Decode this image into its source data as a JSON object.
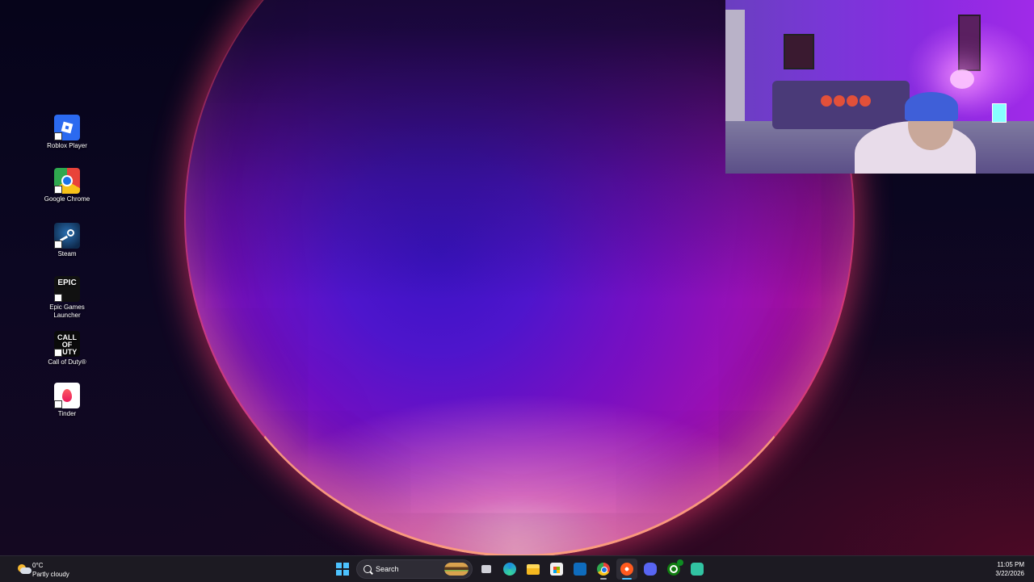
{
  "desktop": {
    "icons": [
      {
        "label": "Roblox Player",
        "icon": "roblox-icon"
      },
      {
        "label": "Google Chrome",
        "icon": "chrome-icon"
      },
      {
        "label": "Steam",
        "icon": "steam-icon"
      },
      {
        "label": "Epic Games Launcher",
        "icon": "epic-games-icon",
        "glyph": "EPIC"
      },
      {
        "label": "Call of Duty®",
        "icon": "call-of-duty-icon",
        "glyph": "CALL OF DUTY"
      },
      {
        "label": "Tinder",
        "icon": "tinder-icon"
      }
    ]
  },
  "taskbar": {
    "weather": {
      "temp": "0°C",
      "condition": "Partly cloudy",
      "icon": "partly-cloudy-icon"
    },
    "search": {
      "placeholder": "Search"
    },
    "apps": [
      {
        "name": "start",
        "icon": "windows-start-icon"
      },
      {
        "name": "task-view",
        "icon": "task-view-icon"
      },
      {
        "name": "edge",
        "icon": "edge-icon"
      },
      {
        "name": "file-explorer",
        "icon": "folder-icon"
      },
      {
        "name": "microsoft-store",
        "icon": "store-icon"
      },
      {
        "name": "outlook",
        "icon": "outlook-icon"
      },
      {
        "name": "chrome",
        "icon": "chrome-icon"
      },
      {
        "name": "ubisoft",
        "icon": "ubisoft-icon",
        "active": true
      },
      {
        "name": "discord",
        "icon": "discord-icon"
      },
      {
        "name": "xbox",
        "icon": "xbox-icon"
      },
      {
        "name": "streamlabs",
        "icon": "streamlabs-icon"
      }
    ],
    "clock": {
      "time": "11:05 PM",
      "date": "3/22/2026"
    }
  },
  "overlay": {
    "type": "webcam-feed"
  },
  "colors": {
    "accent": "#4cc2ff",
    "taskbar": "#1c1a22"
  }
}
